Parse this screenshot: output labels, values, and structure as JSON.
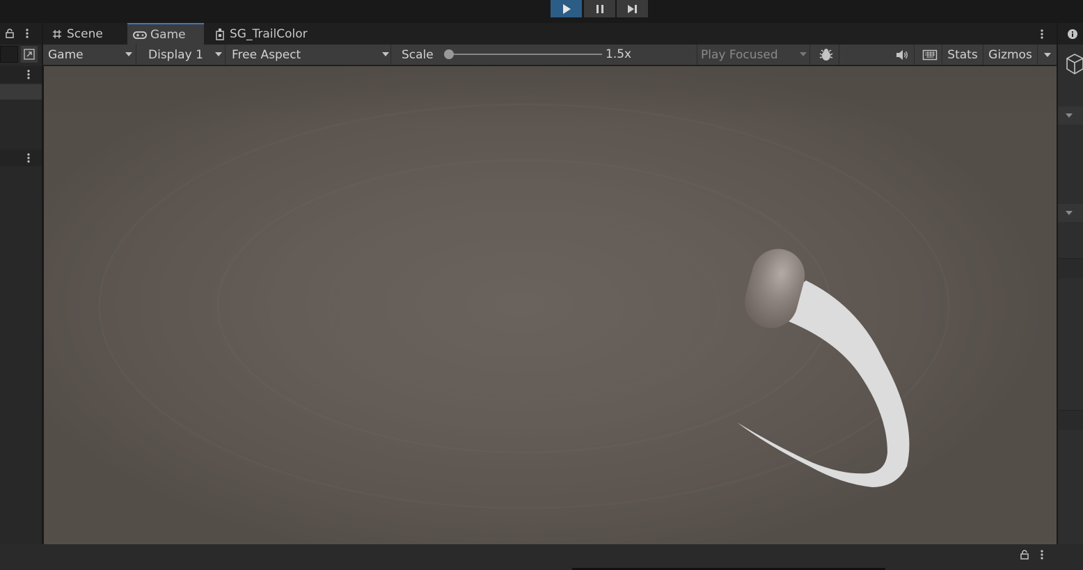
{
  "play_controls": {
    "play": "play-icon",
    "pause": "pause-icon",
    "step": "step-icon",
    "accent": "#2c5d87"
  },
  "tabs": [
    {
      "label": "Scene",
      "icon": "scene-grid-icon"
    },
    {
      "label": "Game",
      "icon": "gamepad-icon"
    },
    {
      "label": "SG_TrailColor",
      "icon": "shader-graph-icon"
    }
  ],
  "toolbar": {
    "view_mode": "Game",
    "display": "Display 1",
    "aspect": "Free Aspect",
    "scale_label": "Scale",
    "scale_value": "1.5x",
    "scale_fraction": 0.0,
    "play_mode": "Play Focused",
    "stats_label": "Stats",
    "gizmos_label": "Gizmos"
  },
  "colors": {
    "floor": "#625a54",
    "trail": "#dcdcdc",
    "capsule": "#8a7f7b",
    "active_tab_border": "#3a79bb"
  }
}
